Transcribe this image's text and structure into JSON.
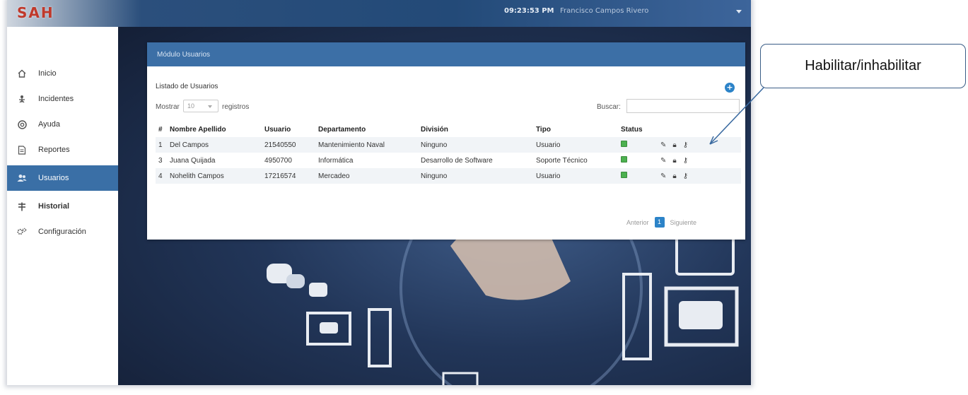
{
  "app": {
    "logo_text": "SAH",
    "time": "09:23:53 PM",
    "user_menu": "Francisco Campos Rivero"
  },
  "sidebar": {
    "items": [
      {
        "label": "Inicio",
        "icon": "home-icon"
      },
      {
        "label": "Incidentes",
        "icon": "incidents-icon"
      },
      {
        "label": "Ayuda",
        "icon": "help-icon"
      },
      {
        "label": "Reportes",
        "icon": "reports-icon"
      },
      {
        "label": "Usuarios",
        "icon": "users-icon",
        "active": true
      },
      {
        "label": "Historial",
        "icon": "history-icon"
      },
      {
        "label": "Configuración",
        "icon": "settings-icon"
      }
    ]
  },
  "panel": {
    "title": "Módulo Usuarios",
    "list_title": "Listado de Usuarios",
    "add_icon": "plus-circle-icon",
    "show_label": "Mostrar",
    "page_size": "10",
    "records_label": "registros",
    "search_label": "Buscar:",
    "search_value": ""
  },
  "table": {
    "headers": [
      "#",
      "Nombre Apellido",
      "Usuario",
      "Departamento",
      "División",
      "Tipo",
      "Status"
    ],
    "rows": [
      {
        "num": "1",
        "name": "Del Campos",
        "user": "21540550",
        "dept": "Mantenimiento Naval",
        "division": "Ninguno",
        "type": "Usuario",
        "status": "active"
      },
      {
        "num": "3",
        "name": "Juana Quijada",
        "user": "4950700",
        "dept": "Informática",
        "division": "Desarrollo de Software",
        "type": "Soporte Técnico",
        "status": "active"
      },
      {
        "num": "4",
        "name": "Nohelith Campos",
        "user": "17216574",
        "dept": "Mercadeo",
        "division": "Ninguno",
        "type": "Usuario",
        "status": "active"
      }
    ],
    "actions": [
      "edit-icon",
      "lock-icon",
      "key-icon"
    ]
  },
  "pager": {
    "prev": "Anterior",
    "current": "1",
    "next": "Siguiente"
  },
  "callout": {
    "text": "Habilitar/inhabilitar"
  },
  "colors": {
    "accent": "#3c6fa6",
    "active_nav": "#3a6fa6",
    "status_green": "#4cb04f",
    "callout_border": "#3a5d86"
  }
}
